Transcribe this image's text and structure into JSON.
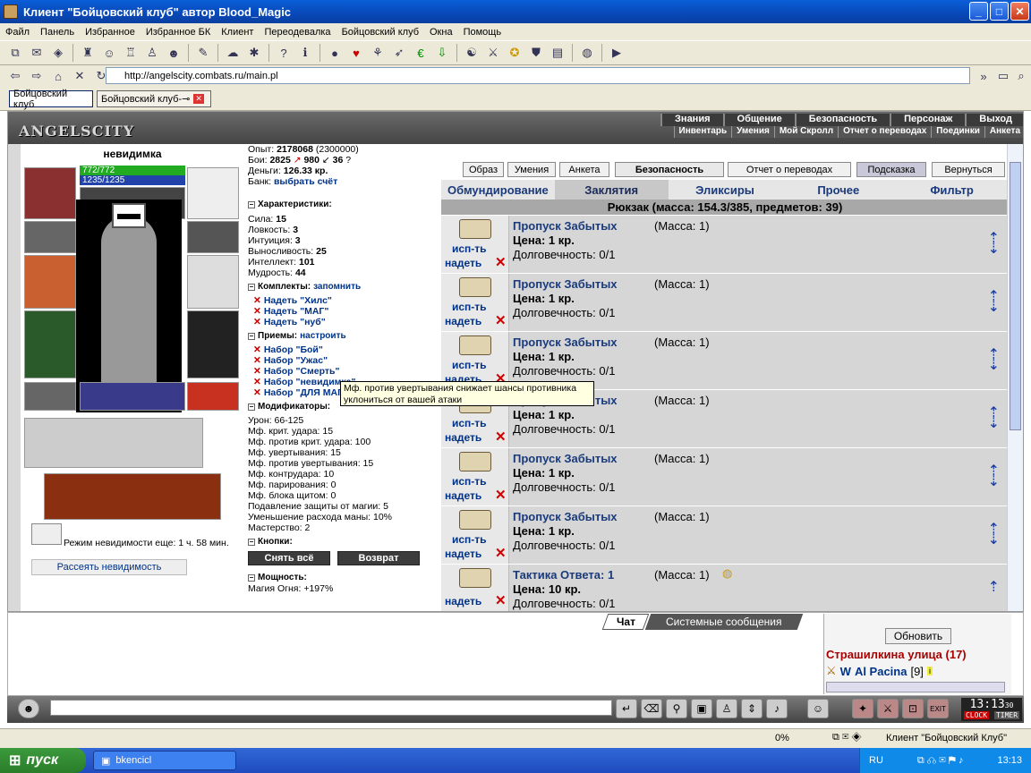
{
  "window": {
    "title": "Клиент \"Бойцовский клуб\" автор Blood_Magic",
    "min": "_",
    "max": "□",
    "close": "✕"
  },
  "menu": [
    "Файл",
    "Панель",
    "Избранное",
    "Избранное БК",
    "Клиент",
    "Переодевалка",
    "Бойцовский клуб",
    "Окна",
    "Помощь"
  ],
  "address": {
    "url": "http://angelscity.combats.ru/main.pl"
  },
  "tabs": [
    {
      "label": "Бойцовский клуб"
    },
    {
      "label": "Бойцовский клуб-⊸"
    }
  ],
  "game": {
    "logo": "ANGELSCITY",
    "topnav": [
      "Знания",
      "Общение",
      "Безопасность",
      "Персонаж",
      "Выход"
    ],
    "subnav": [
      "Инвентарь",
      "Умения",
      "Мой Скролл",
      "Отчет о переводах",
      "Поединки",
      "Анкета"
    ]
  },
  "character": {
    "name": "невидимка",
    "hp": "772/772",
    "mana": "1235/1235",
    "exp_label": "Опыт:",
    "exp": "2178068",
    "exp_next": "(2300000)",
    "fights_label": "Бои:",
    "wins": "2825",
    "losses": "980",
    "draws": "36",
    "draws_mark": "?",
    "money_label": "Деньги:",
    "money": "126.33 кр.",
    "bank_label": "Банк:",
    "bank_link": "выбрать счёт",
    "invis_text": "Режим невидимости еще: 1 ч. 58 мин.",
    "dispel_button": "Рассеять невидимость"
  },
  "characteristics": {
    "title": "Характеристики:",
    "items": [
      {
        "label": "Сила:",
        "value": "15"
      },
      {
        "label": "Ловкость:",
        "value": "3"
      },
      {
        "label": "Интуиция:",
        "value": "3"
      },
      {
        "label": "Выносливость:",
        "value": "25"
      },
      {
        "label": "Интеллект:",
        "value": "101"
      },
      {
        "label": "Мудрость:",
        "value": "44"
      }
    ]
  },
  "sets": {
    "title": "Комплекты:",
    "action": "запомнить",
    "items": [
      "Надеть \"Хилс\"",
      "Надеть \"МАГ\"",
      "Надеть \"нуб\""
    ]
  },
  "techniques": {
    "title": "Приемы:",
    "action": "настроить",
    "items": [
      "Набор \"Бой\"",
      "Набор \"Ужас\"",
      "Набор \"Смерть\"",
      "Набор \"невидимка\"",
      "Набор \"ДЛЯ МАГА\""
    ]
  },
  "modifiers": {
    "title": "Модификаторы:",
    "items": [
      "Урон: 66-125",
      "Мф. крит. удара: 15",
      "Мф. против крит. удара: 100",
      "Мф. увертывания: 15",
      "Мф. против увертывания: 15",
      "Мф. контрудара: 10",
      "Мф. парирования: 0",
      "Мф. блока щитом: 0",
      "Подавление защиты от магии: 5",
      "Уменьшение расхода маны: 10%",
      "Мастерство: 2"
    ]
  },
  "buttons_section": {
    "title": "Кнопки:",
    "remove_all": "Снять всё",
    "return": "Возврат"
  },
  "power": {
    "title": "Мощность:",
    "first": "Магия Огня: +197%"
  },
  "tooltip": "Мф. против увертывания снижает шансы противника уклониться от вашей атаки",
  "right_buttons": [
    "Образ",
    "Умения",
    "Анкета",
    "Безопасность",
    "Отчет о переводах",
    "Подсказка",
    "Вернуться"
  ],
  "inv_tabs": [
    "Обмундирование",
    "Заклятия",
    "Эликсиры",
    "Прочее",
    "Фильтр"
  ],
  "backpack": "Рюкзак (масса: 154.3/385, предметов: 39)",
  "item_actions": {
    "use": "исп-ть",
    "wear": "надеть",
    "delete": "✕"
  },
  "items": [
    {
      "name": "Пропуск Забытых",
      "mass": "(Масса: 1)",
      "price": "Цена: 1 кр.",
      "dur": "Долговечность: 0/1"
    },
    {
      "name": "Пропуск Забытых",
      "mass": "(Масса: 1)",
      "price": "Цена: 1 кр.",
      "dur": "Долговечность: 0/1"
    },
    {
      "name": "Пропуск Забытых",
      "mass": "(Масса: 1)",
      "price": "Цена: 1 кр.",
      "dur": "Долговечность: 0/1"
    },
    {
      "name": "Пропуск Забытых",
      "mass": "(Масса: 1)",
      "price": "Цена: 1 кр.",
      "dur": "Долговечность: 0/1"
    },
    {
      "name": "Пропуск Забытых",
      "mass": "(Масса: 1)",
      "price": "Цена: 1 кр.",
      "dur": "Долговечность: 0/1"
    },
    {
      "name": "Пропуск Забытых",
      "mass": "(Масса: 1)",
      "price": "Цена: 1 кр.",
      "dur": "Долговечность: 0/1"
    },
    {
      "name": "Тактика Ответа: 1",
      "mass": "(Масса: 1)",
      "price": "Цена: 10 кр.",
      "dur": "Долговечность: 0/1"
    }
  ],
  "chat": {
    "tab_chat": "Чат",
    "tab_system": "Системные сообщения"
  },
  "online": {
    "refresh": "Обновить",
    "location": "Страшилкина улица (17)",
    "user": "Al Pacina",
    "level": "[9]"
  },
  "clock": {
    "time": "13:13",
    "sec": "30",
    "clock_label": "CLOCK",
    "timer_label": "TIMER",
    "exit": "EXIT"
  },
  "statusbar": {
    "zoom": "0%",
    "client": "Клиент \"Бойцовский Клуб\""
  },
  "taskbar": {
    "start": "пуск",
    "task": "bkencicl",
    "lang": "RU",
    "time": "13:13"
  },
  "colors": {
    "accent": "#1a3a7a",
    "delete": "#cc0000",
    "hp": "#22aa22",
    "mana": "#2244aa"
  }
}
